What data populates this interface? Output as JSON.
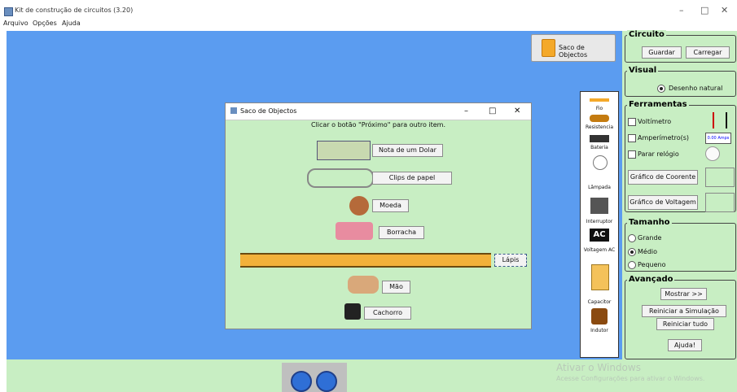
{
  "window": {
    "title": "Kit de construção de circuitos (3.20)",
    "minimize": "–",
    "maximize": "□",
    "close": "✕"
  },
  "menu": [
    "Arquivo",
    "Opções",
    "Ajuda"
  ],
  "saco_button": "Saco de Objectos",
  "toolbox": [
    "Fio",
    "Resistencia",
    "Bateria",
    "Lâmpada",
    "Interruptor",
    "Voltagem AC",
    "Capacitor",
    "Indutor"
  ],
  "toolbox_ac_glyph": "AC",
  "dialog": {
    "title": "Saco de Objectos",
    "instruction": "Clicar o botão \"Próximo\" para outro item.",
    "items": [
      "Nota de um Dolar",
      "Clips de papel",
      "Moeda",
      "Borracha",
      "Lápis",
      "Mão",
      "Cachorro"
    ],
    "minimize": "–",
    "maximize": "□",
    "close": "✕"
  },
  "panel": {
    "circuito": {
      "title": "Circuito",
      "save": "Guardar",
      "load": "Carregar"
    },
    "visual": {
      "title": "Visual",
      "option": "Desenho natural"
    },
    "ferramentas": {
      "title": "Ferramentas",
      "voltimetro": "Voltímetro",
      "amperimetro": "Amperímetro(s)",
      "relogio": "Parar relógio",
      "grafico_corrente": "Gráfico de Coorente",
      "grafico_voltagem": "Gráfico de Voltagem",
      "amps_reading": "0.00 Amps"
    },
    "tamanho": {
      "title": "Tamanho",
      "options": [
        "Grande",
        "Médio",
        "Pequeno"
      ],
      "selected": "Médio"
    },
    "avancado": {
      "title": "Avançado",
      "mostrar": "Mostrar >>",
      "reiniciar_sim": "Reiniciar a Simulação",
      "reiniciar_tudo": "Reiniciar tudo",
      "ajuda": "Ajuda!"
    }
  },
  "watermark": {
    "line1": "Ativar o Windows",
    "line2": "Acesse Configurações para ativar o Windows."
  },
  "colors": {
    "canvas": "#5b9cf0",
    "panel": "#c8eec3"
  }
}
